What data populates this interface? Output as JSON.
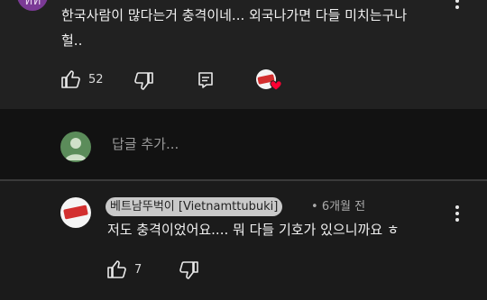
{
  "top_comment": {
    "avatar_letter": "ทท",
    "text_line1": "한국사람이 많다는거 충격이네... 외국나가면 다들 미치는구나",
    "text_line2": "헐..",
    "like_count": "52"
  },
  "reply_box": {
    "placeholder": "답글 추가..."
  },
  "reply": {
    "author": "베트남뚜벅이 [Vietnamttubuki]",
    "separator": "•",
    "time": "6개월 전",
    "text": "저도 충격이었어요.... 뭐 다들 기호가 있으니까요 ㅎ",
    "like_count": "7"
  },
  "colors": {
    "heart": "#ff0033",
    "badge_red": "#d32f2f",
    "page_bg": "#212121",
    "dark_band": "#121212"
  },
  "icons": [
    "thumbs-up-icon",
    "thumbs-down-icon",
    "reply-comment-icon",
    "kebab-menu-icon",
    "creator-heart-icon"
  ]
}
